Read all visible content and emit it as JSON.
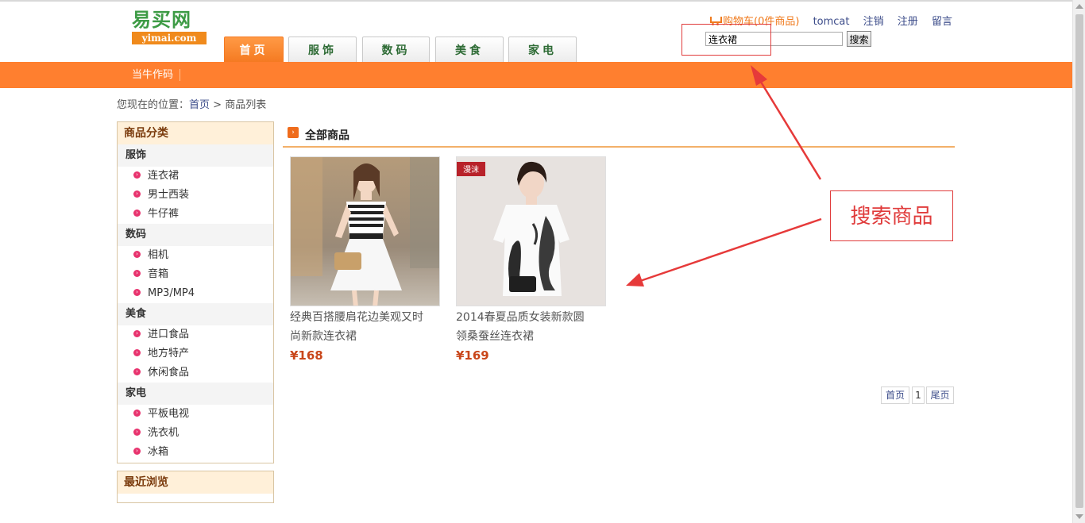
{
  "header": {
    "logo_cn": "易买网",
    "logo_en": "yimai.com",
    "nav": [
      "首页",
      "服饰",
      "数码",
      "美食",
      "家电"
    ],
    "top_links": {
      "cart": "购物车(0件商品)",
      "user": "tomcat",
      "logout": "注销",
      "register": "注册",
      "message": "留言"
    },
    "search": {
      "value": "连衣裙",
      "button": "搜索"
    }
  },
  "subnav": {
    "item": "当牛作码"
  },
  "breadcrumb": {
    "prefix": "您现在的位置：",
    "home": "首页",
    "sep": ">",
    "current": "商品列表"
  },
  "sidebar": {
    "title": "商品分类",
    "groups": [
      {
        "name": "服饰",
        "items": [
          "连衣裙",
          "男士西装",
          "牛仔裤"
        ]
      },
      {
        "name": "数码",
        "items": [
          "相机",
          "音箱",
          "MP3/MP4"
        ]
      },
      {
        "name": "美食",
        "items": [
          "进口食品",
          "地方特产",
          "休闲食品"
        ]
      },
      {
        "name": "家电",
        "items": [
          "平板电视",
          "洗衣机",
          "冰箱"
        ]
      }
    ],
    "recent_title": "最近浏览"
  },
  "main": {
    "title": "全部商品",
    "products": [
      {
        "name_line1": "经典百搭腰肩花边美观又时",
        "name_line2": "尚新款连衣裙",
        "price": "¥168"
      },
      {
        "name_line1": "2014春夏品质女装新款圆",
        "name_line2": "领桑蚕丝连衣裙",
        "price": "¥169",
        "tag": "漫沫"
      }
    ],
    "pager": {
      "first": "首页",
      "page": "1",
      "last": "尾页"
    }
  },
  "annotation": {
    "label": "搜索商品"
  },
  "colors": {
    "orange": "#ff7f2f",
    "annotation_red": "#e03b3b",
    "price": "#c9461a"
  }
}
